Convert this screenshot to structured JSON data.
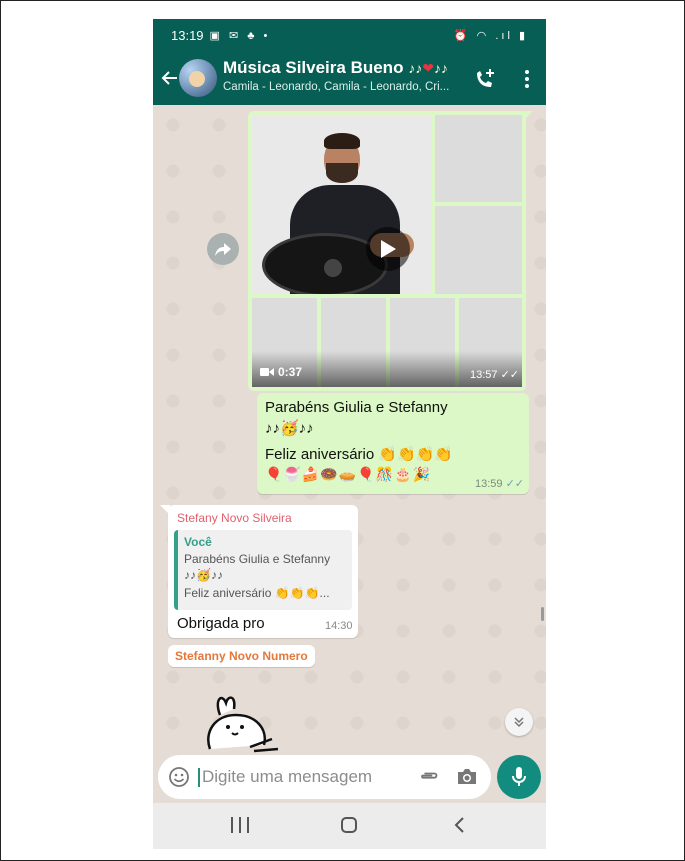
{
  "status_bar": {
    "time": "13:19",
    "left_icons": "▣ ✉ ♣ •",
    "right_icons": "⏰ ◠ .ıl ▮"
  },
  "header": {
    "title": "Música Silveira Bueno",
    "title_emoji_left": "♪♪",
    "title_emoji_heart": "❤",
    "title_emoji_right": "♪♪",
    "participants": "Camila - Leonardo, Camila - Leonardo, Cri..."
  },
  "messages": {
    "media": {
      "duration": "0:37",
      "time": "13:57",
      "ticks": "✓✓"
    },
    "birthday": {
      "line1": "Parabéns Giulia e Stefanny",
      "line2": "♪♪🥳♪♪",
      "line3": "Feliz aniversário 👏👏👏👏",
      "line4": "🎈🍧🍰🍩🥧🎈🎊🎂🎉",
      "time": "13:59",
      "ticks": "✓✓"
    },
    "reply": {
      "sender": "Stefany Novo Silveira",
      "quote_author": "Você",
      "quote_line1": "Parabéns Giulia e Stefanny",
      "quote_line2": "♪♪🥳♪♪",
      "quote_line3": "Feliz aniversário 👏👏👏...",
      "text": "Obrigada pro",
      "time": "14:30"
    },
    "next_sender": "Stefanny Novo Numero"
  },
  "composer": {
    "placeholder": "Digite uma mensagem"
  },
  "colors": {
    "header": "#075e54",
    "outgoing_bubble": "#dcf8c6",
    "accent": "#128c7e",
    "sender1": "#e0616d",
    "sender2": "#e4783a"
  },
  "icons": [
    "back-arrow-icon",
    "add-call-icon",
    "more-options-icon",
    "forward-icon",
    "play-icon",
    "video-camera-icon",
    "chevron-down-icon",
    "emoji-icon",
    "attach-icon",
    "camera-icon",
    "mic-icon",
    "recents-icon",
    "home-icon",
    "nav-back-icon"
  ]
}
